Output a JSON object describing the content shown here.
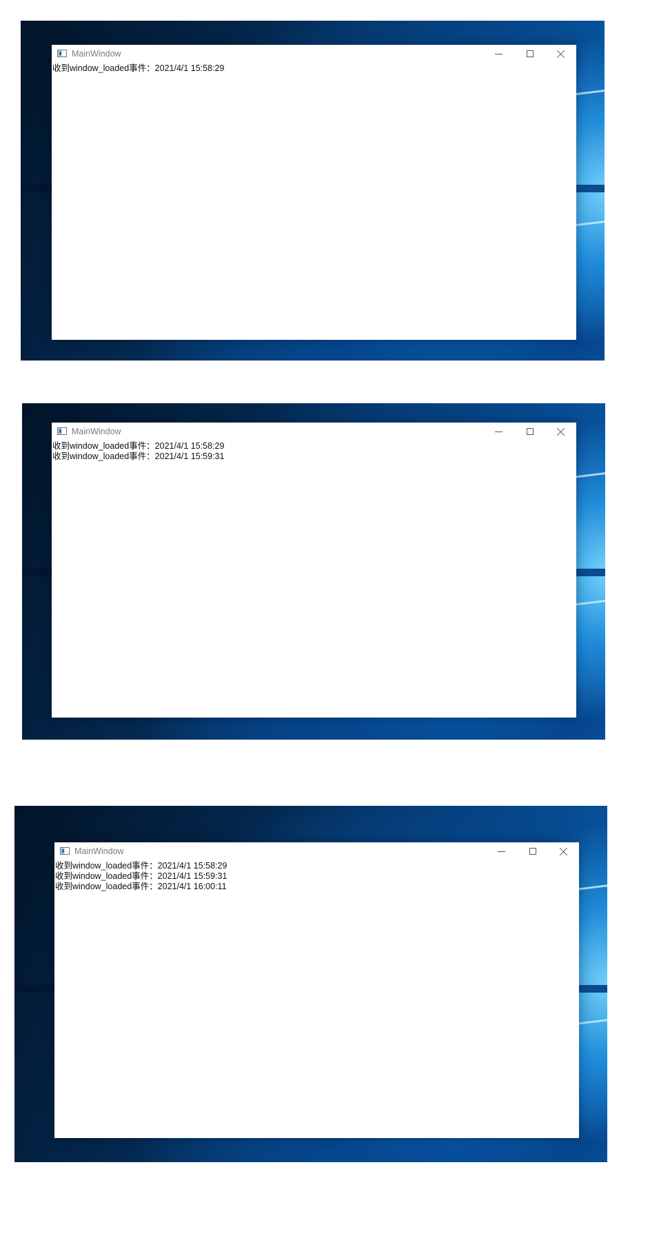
{
  "screenshots": [
    {
      "window": {
        "title": "MainWindow",
        "log_lines": [
          "收到window_loaded事件：2021/4/1 15:58:29"
        ]
      }
    },
    {
      "window": {
        "title": "MainWindow",
        "log_lines": [
          "收到window_loaded事件：2021/4/1 15:58:29",
          "收到window_loaded事件：2021/4/1 15:59:31"
        ]
      }
    },
    {
      "window": {
        "title": "MainWindow",
        "log_lines": [
          "收到window_loaded事件：2021/4/1 15:58:29",
          "收到window_loaded事件：2021/4/1 15:59:31",
          "收到window_loaded事件：2021/4/1 16:00:11"
        ]
      }
    }
  ],
  "icons": {
    "app": "application-window-icon",
    "minimize": "minimize-icon",
    "maximize": "maximize-icon",
    "close": "close-icon"
  },
  "colors": {
    "desktop_dark": "#021428",
    "desktop_mid": "#064a8d",
    "desktop_light": "#78d7ff",
    "window_bg": "#ffffff",
    "title_text": "#7a7a7a",
    "body_text": "#111111"
  }
}
